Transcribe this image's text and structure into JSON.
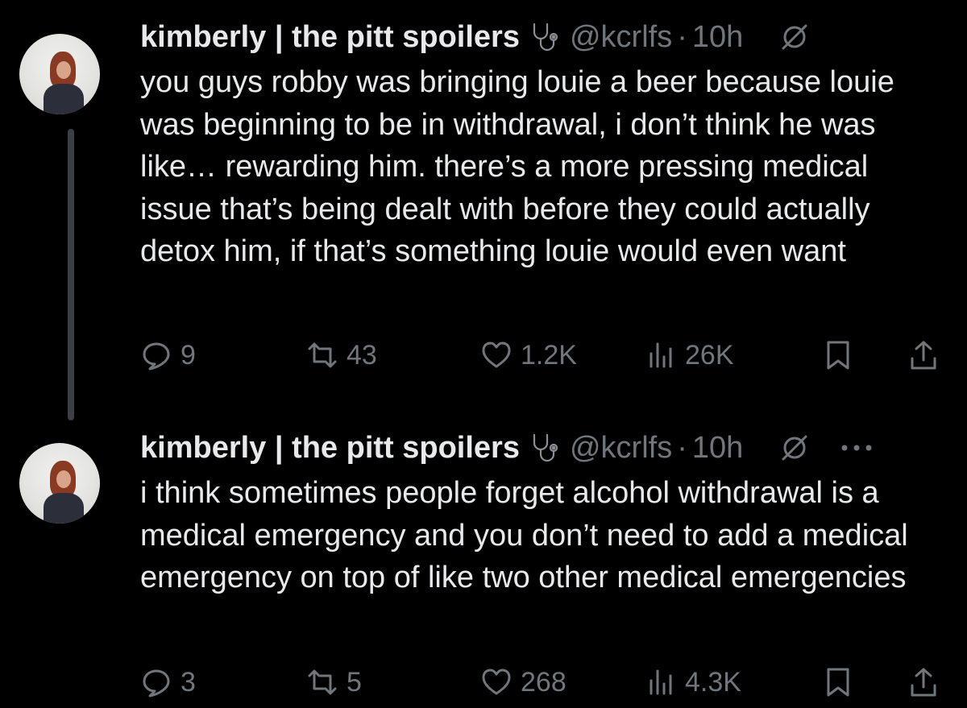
{
  "tweets": [
    {
      "name": "kimberly | the pitt spoilers",
      "handle": "@kcrlfs",
      "dot": "·",
      "time": "10h",
      "text": "you guys robby was bringing louie a beer because louie was beginning to be in withdrawal, i don’t think he was like… rewarding him. there’s a more pressing medical issue that’s being dealt with before they could actually detox him, if that’s something louie would even want",
      "stats": {
        "replies": "9",
        "reposts": "43",
        "likes": "1.2K",
        "views": "26K"
      },
      "icons": [
        "stethoscope-icon",
        "grok-icon",
        "reply-icon",
        "repost-icon",
        "heart-icon",
        "views-icon",
        "bookmark-icon",
        "share-icon"
      ]
    },
    {
      "name": "kimberly | the pitt spoilers",
      "handle": "@kcrlfs",
      "dot": "·",
      "time": "10h",
      "text": "i think sometimes people forget alcohol withdrawal is a medical emergency and you don’t need to add a medical emergency on top of like two other medical emergencies",
      "stats": {
        "replies": "3",
        "reposts": "5",
        "likes": "268",
        "views": "4.3K"
      },
      "icons": [
        "stethoscope-icon",
        "grok-icon",
        "more-icon",
        "reply-icon",
        "repost-icon",
        "heart-icon",
        "views-icon",
        "bookmark-icon",
        "share-icon"
      ]
    }
  ],
  "colors": {
    "background": "#000000",
    "primary_text": "#e7e9ea",
    "secondary_text": "#71767b",
    "thread_line": "#3c3f44"
  }
}
